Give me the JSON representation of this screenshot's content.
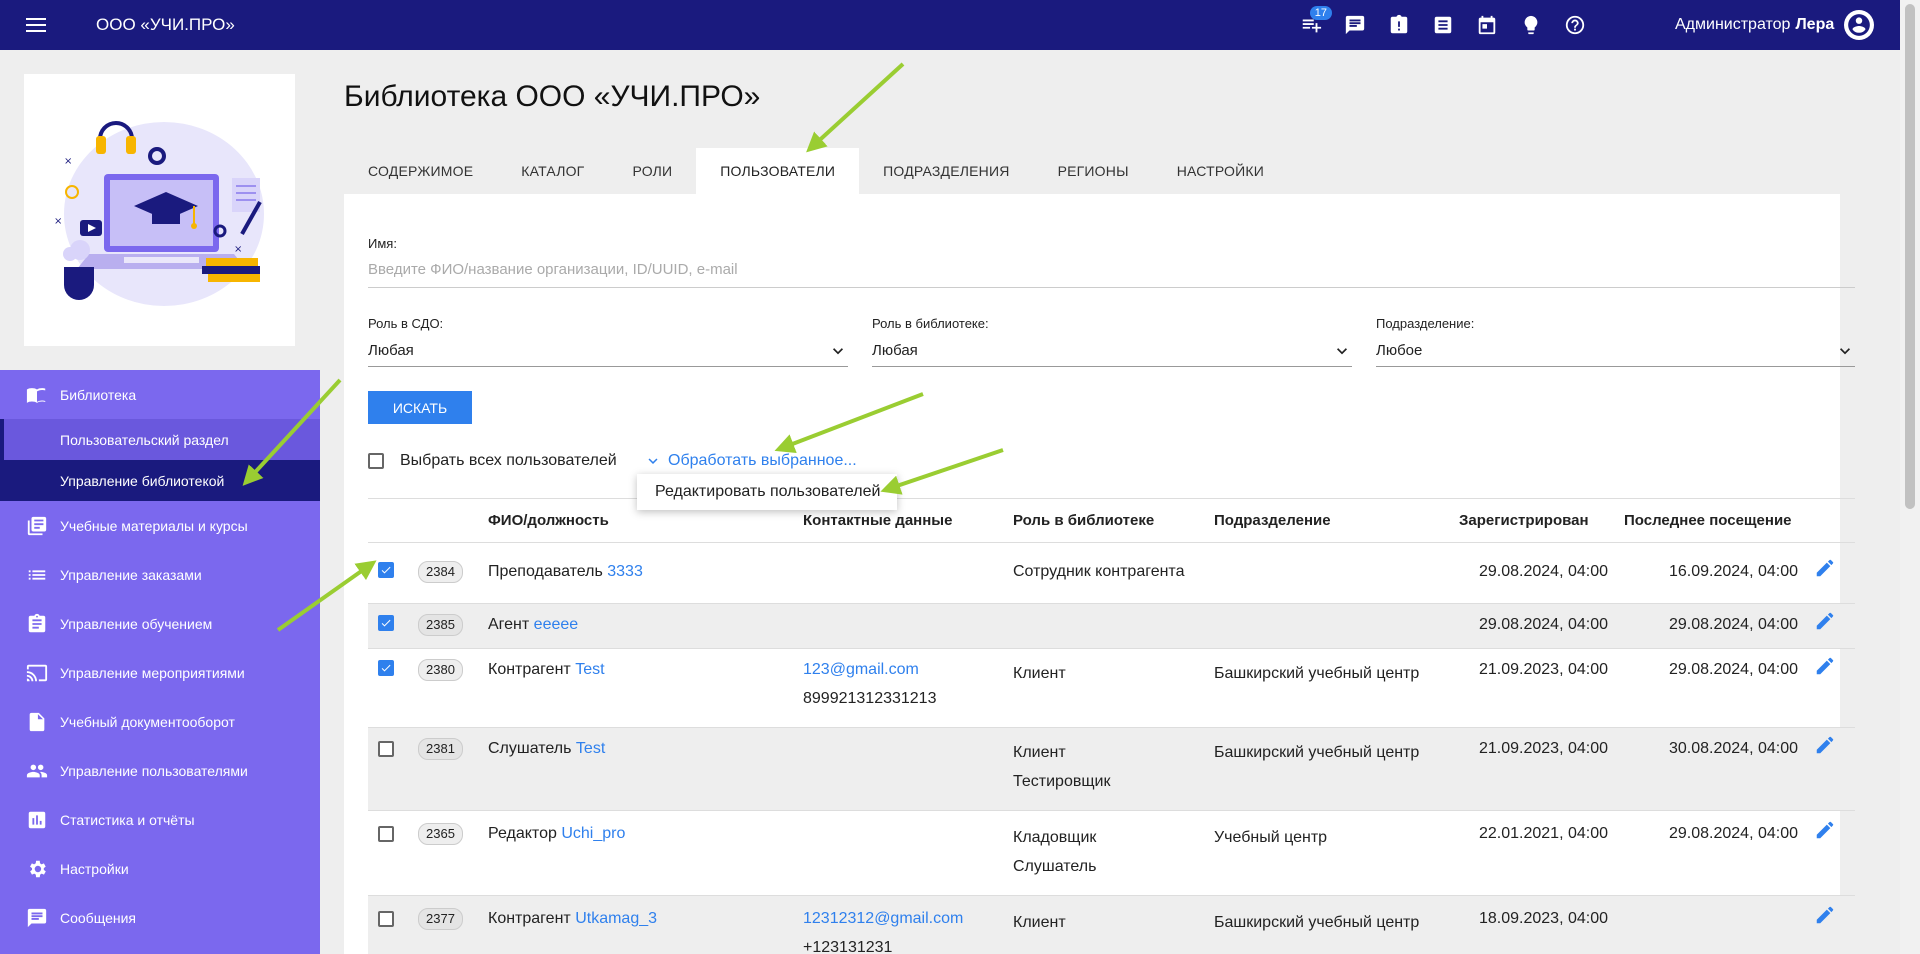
{
  "header": {
    "org_name": "ООО «УЧИ.ПРО»",
    "notifications_count": "17",
    "icons": [
      "list-icon",
      "chat-icon",
      "clipboard-icon",
      "document-icon",
      "calendar-icon",
      "lightbulb-icon",
      "help-icon"
    ],
    "user_role": "Администратор",
    "user_name": "Лера"
  },
  "sidebar": {
    "library": "Библиотека",
    "user_section": "Пользовательский раздел",
    "library_management": "Управление библиотекой",
    "items": [
      {
        "label": "Учебные материалы и курсы",
        "icon": "library-books-icon"
      },
      {
        "label": "Управление заказами",
        "icon": "list-icon"
      },
      {
        "label": "Управление обучением",
        "icon": "assignment-icon"
      },
      {
        "label": "Управление мероприятиями",
        "icon": "cast-icon"
      },
      {
        "label": "Учебный документооборот",
        "icon": "file-icon"
      },
      {
        "label": "Управление пользователями",
        "icon": "people-icon"
      },
      {
        "label": "Статистика и отчёты",
        "icon": "chart-icon"
      },
      {
        "label": "Настройки",
        "icon": "gear-icon"
      },
      {
        "label": "Сообщения",
        "icon": "chat-icon"
      }
    ]
  },
  "main": {
    "title": "Библиотека ООО «УЧИ.ПРО»",
    "tabs": [
      "СОДЕРЖИМОЕ",
      "КАТАЛОГ",
      "РОЛИ",
      "ПОЛЬЗОВАТЕЛИ",
      "ПОДРАЗДЕЛЕНИЯ",
      "РЕГИОНЫ",
      "НАСТРОЙКИ"
    ],
    "active_tab": "ПОЛЬЗОВАТЕЛИ"
  },
  "filters": {
    "name_label": "Имя:",
    "name_placeholder": "Введите ФИО/название организации, ID/UUID, e-mail",
    "sdo_role_label": "Роль в СДО:",
    "sdo_role_value": "Любая",
    "library_role_label": "Роль в библиотеке:",
    "library_role_value": "Любая",
    "department_label": "Подразделение:",
    "department_value": "Любое",
    "search_button": "ИСКАТЬ"
  },
  "bulk": {
    "select_all": "Выбрать всех пользователей",
    "process_selected": "Обработать выбранное...",
    "dropdown_item": "Редактировать пользователей"
  },
  "table": {
    "headers": [
      "ФИО/должность",
      "Контактные данные",
      "Роль в библиотеке",
      "Подразделение",
      "Зарегистрирован",
      "Последнее посещение"
    ],
    "rows": [
      {
        "checked": true,
        "id": "2384",
        "position": "Преподаватель",
        "name": "3333",
        "email": "",
        "phone": "",
        "roles": [
          "Сотрудник контрагента"
        ],
        "department": "",
        "registered": "29.08.2024, 04:00",
        "last_visit": "16.09.2024, 04:00"
      },
      {
        "checked": true,
        "id": "2385",
        "position": "Агент",
        "name": "eeeee",
        "email": "",
        "phone": "",
        "roles": [],
        "department": "",
        "registered": "29.08.2024, 04:00",
        "last_visit": "29.08.2024, 04:00"
      },
      {
        "checked": true,
        "id": "2380",
        "position": "Контрагент",
        "name": "Test",
        "email": "123@gmail.com",
        "phone": "899921312331213",
        "roles": [
          "Клиент"
        ],
        "department": "Башкирский учебный центр",
        "registered": "21.09.2023, 04:00",
        "last_visit": "29.08.2024, 04:00"
      },
      {
        "checked": false,
        "id": "2381",
        "position": "Слушатель",
        "name": "Test",
        "email": "",
        "phone": "",
        "roles": [
          "Клиент",
          "Тестировщик"
        ],
        "department": "Башкирский учебный центр",
        "registered": "21.09.2023, 04:00",
        "last_visit": "30.08.2024, 04:00"
      },
      {
        "checked": false,
        "id": "2365",
        "position": "Редактор",
        "name": "Uchi_pro",
        "email": "",
        "phone": "",
        "roles": [
          "Кладовщик",
          "Слушатель"
        ],
        "department": "Учебный центр",
        "registered": "22.01.2021, 04:00",
        "last_visit": "29.08.2024, 04:00"
      },
      {
        "checked": false,
        "id": "2377",
        "position": "Контрагент",
        "name": "Utkamag_3",
        "email": "12312312@gmail.com",
        "phone": "+123131231",
        "roles": [
          "Клиент"
        ],
        "department": "Башкирский учебный центр",
        "registered": "18.09.2023, 04:00",
        "last_visit": ""
      }
    ]
  },
  "colors": {
    "topbar": "#1a1a7e",
    "sidebar_nav": "#7b68ee",
    "accent": "#2f80ed",
    "annotation_arrow": "#9acd32"
  }
}
